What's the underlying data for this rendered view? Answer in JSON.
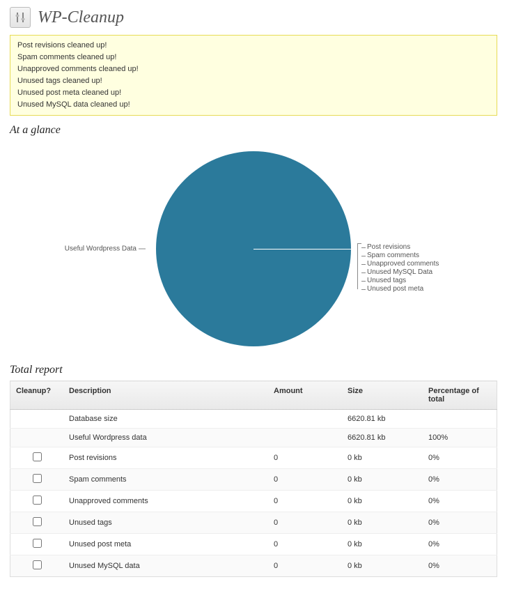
{
  "page_title": "WP-Cleanup",
  "notices": [
    "Post revisions cleaned up!",
    "Spam comments cleaned up!",
    "Unapproved comments cleaned up!",
    "Unused tags cleaned up!",
    "Unused post meta cleaned up!",
    "Unused MySQL data cleaned up!"
  ],
  "sections": {
    "glance": "At a glance",
    "report": "Total report"
  },
  "chart_data": {
    "type": "pie",
    "title": "",
    "series": [
      {
        "name": "Useful Wordpress Data",
        "value": 6620.81
      },
      {
        "name": "Post revisions",
        "value": 0
      },
      {
        "name": "Spam comments",
        "value": 0
      },
      {
        "name": "Unapproved comments",
        "value": 0
      },
      {
        "name": "Unused MySQL Data",
        "value": 0
      },
      {
        "name": "Unused tags",
        "value": 0
      },
      {
        "name": "Unused post meta",
        "value": 0
      }
    ],
    "colors": {
      "primary": "#2b7a9b"
    },
    "left_label": "Useful Wordpress Data",
    "right_labels": [
      "Post revisions",
      "Spam comments",
      "Unapproved comments",
      "Unused MySQL Data",
      "Unused tags",
      "Unused post meta"
    ]
  },
  "table": {
    "headers": {
      "cleanup": "Cleanup?",
      "description": "Description",
      "amount": "Amount",
      "size": "Size",
      "percentage": "Percentage of total"
    },
    "rows": [
      {
        "checkbox": false,
        "description": "Database size",
        "amount": "",
        "size": "6620.81 kb",
        "percentage": ""
      },
      {
        "checkbox": false,
        "description": "Useful Wordpress data",
        "amount": "",
        "size": "6620.81 kb",
        "percentage": "100%"
      },
      {
        "checkbox": true,
        "description": "Post revisions",
        "amount": "0",
        "size": "0 kb",
        "percentage": "0%"
      },
      {
        "checkbox": true,
        "description": "Spam comments",
        "amount": "0",
        "size": "0 kb",
        "percentage": "0%"
      },
      {
        "checkbox": true,
        "description": "Unapproved comments",
        "amount": "0",
        "size": "0 kb",
        "percentage": "0%"
      },
      {
        "checkbox": true,
        "description": "Unused tags",
        "amount": "0",
        "size": "0 kb",
        "percentage": "0%"
      },
      {
        "checkbox": true,
        "description": "Unused post meta",
        "amount": "0",
        "size": "0 kb",
        "percentage": "0%"
      },
      {
        "checkbox": true,
        "description": "Unused MySQL data",
        "amount": "0",
        "size": "0 kb",
        "percentage": "0%"
      }
    ]
  }
}
